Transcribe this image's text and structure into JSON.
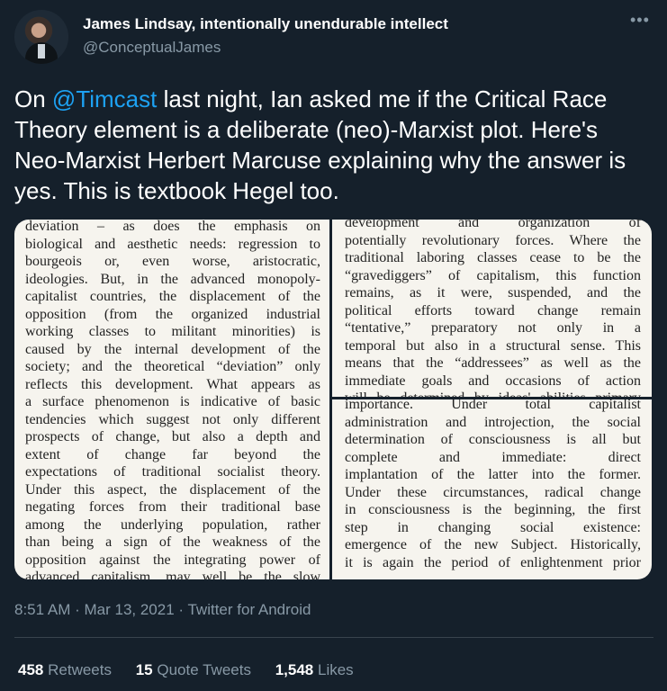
{
  "author": {
    "display_name": "James Lindsay, intentionally unendurable intellect",
    "handle": "@ConceptualJames"
  },
  "more_icon": "more-horizontal-icon",
  "tweet": {
    "prefix": "On ",
    "mention": "@Timcast",
    "rest": " last night, Ian asked me if the Critical Race Theory element is a deliberate (neo)-Marxist plot. Here's Neo-Marxist Herbert Marcuse explaining why the answer is yes. This is textbook Hegel too."
  },
  "media": {
    "left_page": [
      "deviation – as does the emphasis on",
      "biological and aesthetic needs: regression to",
      "bourgeois or, even worse, aristocratic,",
      "ideologies. But, in the advanced monopoly-",
      "capitalist countries, the displacement of the",
      "opposition (from the organized industrial",
      "working classes to militant minorities) is",
      "caused by the internal development of the",
      "society; and the theoretical “deviation” only",
      "reflects this development. What appears as",
      "a surface phenomenon is indicative of basic",
      "tendencies which suggest not only different",
      "prospects of change, but also a depth and",
      "extent of change far beyond the",
      "expectations of traditional socialist theory.",
      "Under this aspect, the displacement of the",
      "negating forces from their traditional base",
      "among the underlying population, rather",
      "than being a sign of the weakness of the",
      "opposition against the integrating power of",
      "advanced capitalism, may well be the slow"
    ],
    "right_top": [
      "development and organization of",
      "potentially revolutionary forces. Where the",
      "traditional laboring classes cease to be the",
      "“gravediggers” of capitalism, this function",
      "remains, as it were, suspended, and the",
      "political efforts toward change remain",
      "“tentative,” preparatory not only in a",
      "temporal but also in a structural sense. This",
      "means that the “addressees” as well as the",
      "immediate goals and occasions of action",
      "will be determined by ideas' abilities primary"
    ],
    "right_bottom": [
      "importance. Under total capitalist",
      "administration and introjection, the social",
      "determination of consciousness is all but",
      "complete and immediate: direct",
      "implantation of the latter into the former.",
      "Under these circumstances, radical change",
      "in consciousness is the beginning, the first",
      "step in changing social existence:",
      "emergence of the new Subject. Historically,",
      "it is again the period of enlightenment prior"
    ]
  },
  "meta": {
    "time": "8:51 AM",
    "date": "Mar 13, 2021",
    "source": "Twitter for Android",
    "separator": " · "
  },
  "stats": [
    {
      "count": "458",
      "label": "Retweets"
    },
    {
      "count": "15",
      "label": "Quote Tweets"
    },
    {
      "count": "1,548",
      "label": "Likes"
    }
  ]
}
